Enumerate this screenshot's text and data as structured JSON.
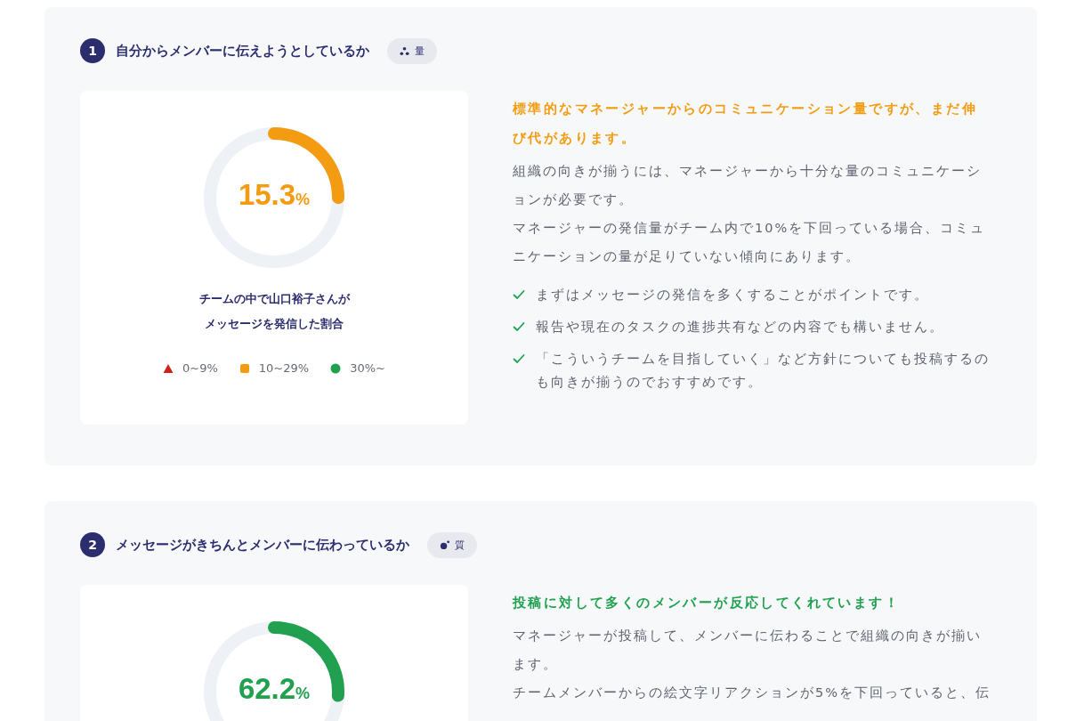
{
  "sections": [
    {
      "number": "1",
      "title": "自分からメンバーに伝えようとしているか",
      "badge": {
        "kind": "quantity",
        "label": "量"
      },
      "gauge": {
        "value": "15.3",
        "unit": "%",
        "level": 0.25,
        "color": "#f39c12"
      },
      "caption": "チームの中で山口裕子さんがメッセージを発信した割合",
      "legend": [
        {
          "kind": "triangle",
          "label": "0~9%",
          "color": "#d0201c"
        },
        {
          "kind": "square",
          "label": "10~29%",
          "color": "#f39c12"
        },
        {
          "kind": "circle",
          "label": "30%~",
          "color": "#21a150"
        }
      ],
      "headline": "標準的なマネージャーからのコミュニケーション量ですが、まだ伸び代があります。",
      "paragraphs": [
        "組織の向きが揃うには、マネージャーから十分な量のコミュニケーションが必要です。",
        "マネージャーの発信量がチーム内で10%を下回っている場合、コミュニケーションの量が足りていない傾向にあります。"
      ],
      "checks": [
        "まずはメッセージの発信を多くすることがポイントです。",
        "報告や現在のタスクの進捗共有などの内容でも構いません。",
        "「こういうチームを目指していく」など方針についても投稿するのも向きが揃うのでおすすめです。"
      ]
    },
    {
      "number": "2",
      "title": "メッセージがきちんとメンバーに伝わっているか",
      "badge": {
        "kind": "quality",
        "label": "質"
      },
      "gauge": {
        "value": "62.2",
        "unit": "%",
        "level": 0.26,
        "color": "#21a150"
      },
      "headline": "投稿に対して多くのメンバーが反応してくれています！",
      "paragraphs": [
        "マネージャーが投稿して、メンバーに伝わることで組織の向きが揃います。",
        "チームメンバーからの絵文字リアクションが5%を下回っていると、伝"
      ]
    }
  ]
}
